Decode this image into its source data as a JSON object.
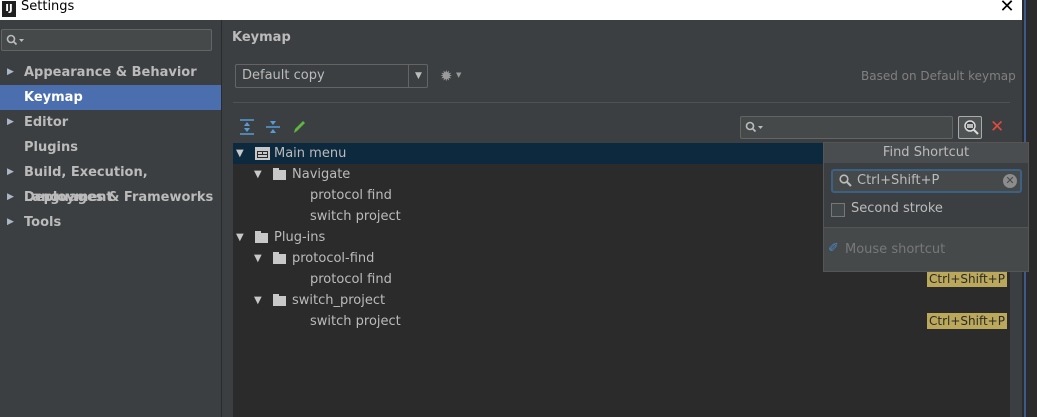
{
  "window": {
    "title": "Settings",
    "app_icon": "IJ",
    "close": "✕"
  },
  "sidebar": {
    "search_placeholder": "",
    "items": [
      {
        "label": "Appearance & Behavior",
        "expandable": true
      },
      {
        "label": "Keymap",
        "selected": true
      },
      {
        "label": "Editor",
        "expandable": true
      },
      {
        "label": "Plugins"
      },
      {
        "label": "Build, Execution, Deployment",
        "expandable": true
      },
      {
        "label": "Languages & Frameworks",
        "expandable": true
      },
      {
        "label": "Tools",
        "expandable": true
      }
    ]
  },
  "main": {
    "title": "Keymap",
    "keymap_select": "Default copy",
    "based_on": "Based on Default keymap"
  },
  "tree": {
    "rows": [
      {
        "label": "Main menu",
        "level": 0,
        "expanded": true,
        "selected": true,
        "icon": "main-menu-icon"
      },
      {
        "label": "Navigate",
        "level": 1,
        "expanded": true,
        "icon": "folder-icon"
      },
      {
        "label": "protocol find",
        "level": 2
      },
      {
        "label": "switch project",
        "level": 2
      },
      {
        "label": "Plug-ins",
        "level": 0,
        "expanded": true,
        "icon": "folder-icon"
      },
      {
        "label": "protocol-find",
        "level": 1,
        "expanded": true,
        "icon": "folder-icon"
      },
      {
        "label": "protocol find",
        "level": 2,
        "shortcut": "Ctrl+Shift+P"
      },
      {
        "label": "switch_project",
        "level": 1,
        "expanded": true,
        "icon": "folder-icon"
      },
      {
        "label": "switch project",
        "level": 2,
        "shortcut": "Ctrl+Shift+P"
      }
    ]
  },
  "find_popup": {
    "title": "Find Shortcut",
    "input_value": "Ctrl+Shift+P",
    "second_stroke_label": "Second stroke",
    "second_stroke_checked": false,
    "mouse_shortcut_label": "Mouse shortcut"
  },
  "colors": {
    "selection": "#4b6eaf",
    "tree_selection": "#0d293e",
    "shortcut_highlight": "#bba85a",
    "clear_red": "#e04b40"
  }
}
